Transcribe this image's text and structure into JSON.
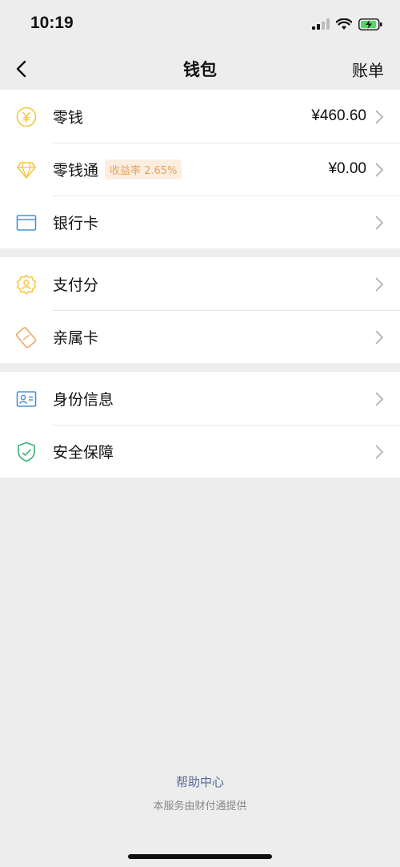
{
  "status_bar": {
    "time": "10:19"
  },
  "nav": {
    "title": "钱包",
    "right_label": "账单"
  },
  "groups": [
    {
      "items": [
        {
          "label": "零钱",
          "value": "¥460.60",
          "icon": "coin-icon"
        },
        {
          "label": "零钱通",
          "badge": "收益率 2.65%",
          "value": "¥0.00",
          "icon": "diamond-icon"
        },
        {
          "label": "银行卡",
          "icon": "bank-card-icon"
        }
      ]
    },
    {
      "items": [
        {
          "label": "支付分",
          "icon": "badge-icon"
        },
        {
          "label": "亲属卡",
          "icon": "family-card-icon"
        }
      ]
    },
    {
      "items": [
        {
          "label": "身份信息",
          "icon": "id-card-icon"
        },
        {
          "label": "安全保障",
          "icon": "shield-icon"
        }
      ]
    }
  ],
  "footer": {
    "help_link": "帮助中心",
    "note": "本服务由财付通提供"
  },
  "colors": {
    "accent_gold": "#f5c543",
    "accent_blue": "#4a90d9",
    "accent_green": "#3cb371",
    "link": "#576b95",
    "badge_bg": "#fbeee1",
    "badge_text": "#e8a15b"
  }
}
